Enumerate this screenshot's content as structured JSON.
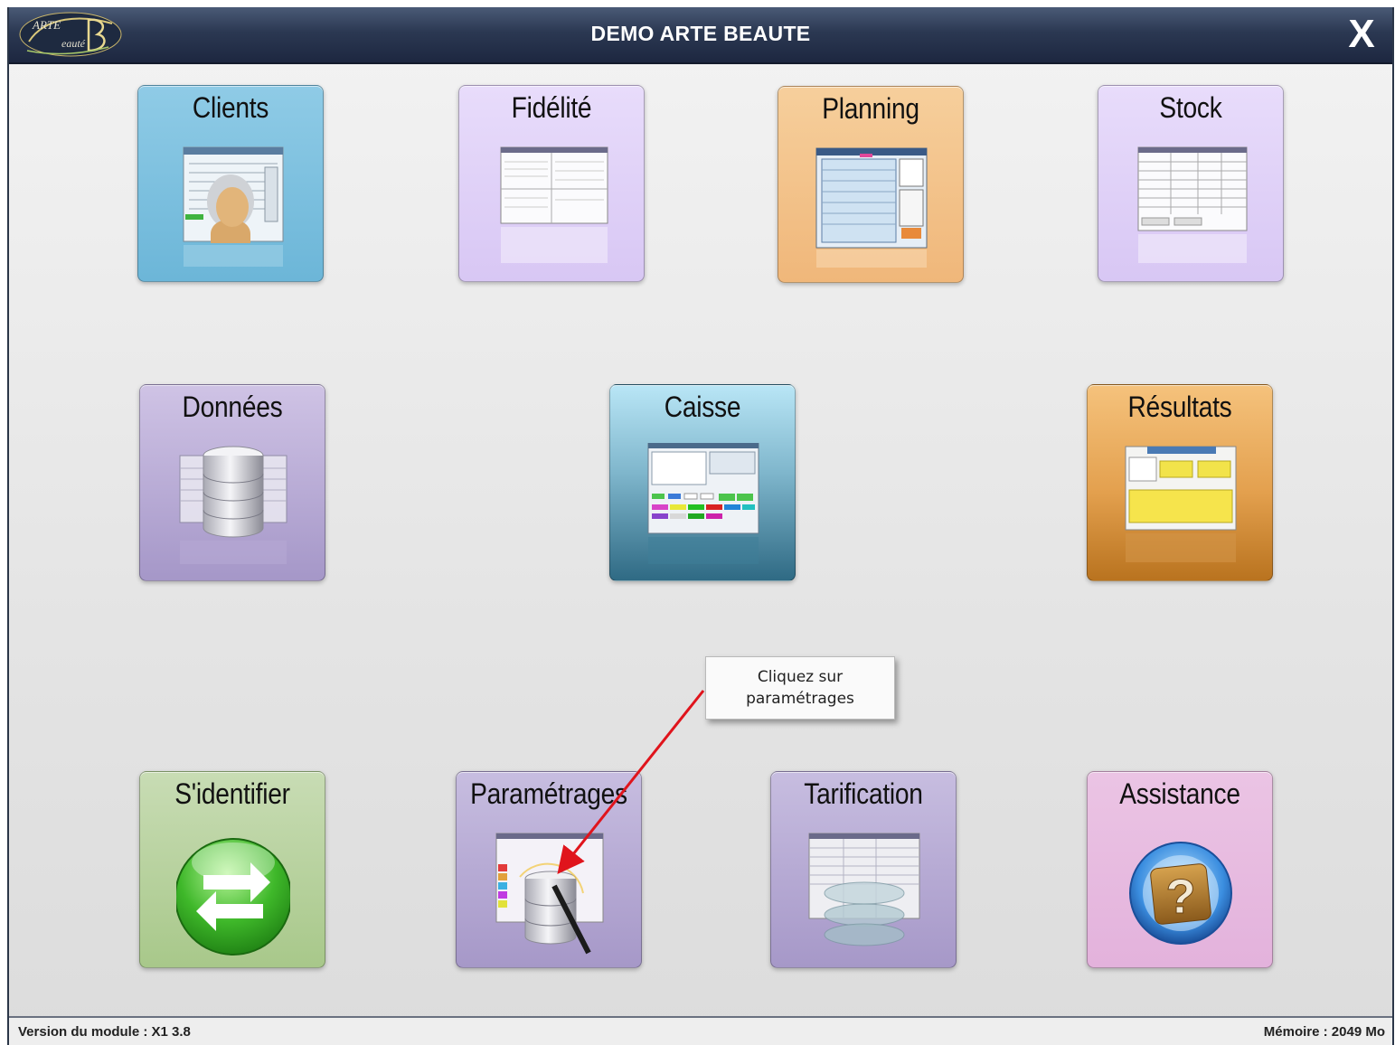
{
  "app": {
    "title": "DEMO ARTE BEAUTE",
    "close_label": "X",
    "logo_text": "Arte Beauté"
  },
  "tiles": [
    {
      "label": "Clients"
    },
    {
      "label": "Fidélité"
    },
    {
      "label": "Planning"
    },
    {
      "label": "Stock"
    },
    {
      "label": "Données"
    },
    {
      "label": "Caisse"
    },
    {
      "label": "Résultats"
    },
    {
      "label": "S'identifier"
    },
    {
      "label": "Paramétrages"
    },
    {
      "label": "Tarification"
    },
    {
      "label": "Assistance"
    }
  ],
  "callout": {
    "line1": "Cliquez sur",
    "line2": "paramétrages",
    "arrow_color": "#e0141c"
  },
  "status": {
    "version": "Version du module :  X1 3.8",
    "memory": "Mémoire : 2049 Mo"
  },
  "colors": {
    "titlebar": "#2b3852",
    "accent_red": "#e0141c"
  }
}
